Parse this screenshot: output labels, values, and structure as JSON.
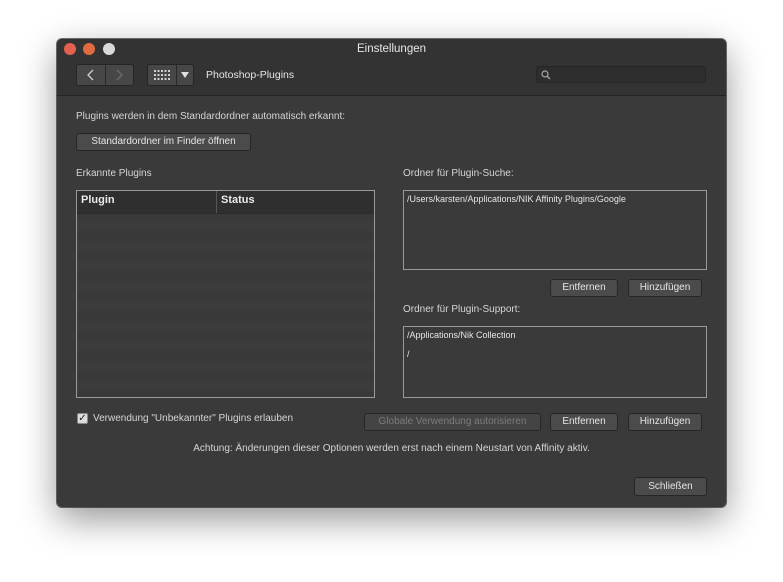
{
  "window": {
    "title": "Einstellungen"
  },
  "toolbar": {
    "back_icon": "chevron-left-icon",
    "forward_icon": "chevron-right-icon",
    "grid_icon": "grid-icon",
    "menu_icon": "triangle-down-icon",
    "section_title": "Photoshop-Plugins",
    "search_icon": "search-icon",
    "search_value": ""
  },
  "main": {
    "auto_detect_text": "Plugins werden in dem Standardordner automatisch erkannt:",
    "open_default_folder_button": "Standardordner im Finder öffnen",
    "detected_plugins_label": "Erkannte Plugins",
    "plugins_table": {
      "columns": [
        "Plugin",
        "Status"
      ],
      "rows": []
    },
    "search_folders_label": "Ordner für Plugin-Suche:",
    "search_folders": [
      "/Users/karsten/Applications/NIK Affinity Plugins/Google"
    ],
    "search_remove_button": "Entfernen",
    "search_add_button": "Hinzufügen",
    "support_folders_label": "Ordner für Plugin-Support:",
    "support_folders": [
      "/Applications/Nik Collection",
      "/"
    ],
    "support_remove_button": "Entfernen",
    "support_add_button": "Hinzufügen",
    "allow_unknown_label": "Verwendung \"Unbekannter\" Plugins erlauben",
    "allow_unknown_checked": true,
    "authorize_global_button": "Globale Verwendung autorisieren",
    "warning_text": "Achtung: Änderungen dieser Optionen werden erst nach einem Neustart von Affinity aktiv.",
    "close_button": "Schließen"
  },
  "colors": {
    "window_bg": "#3a3a3a",
    "titlebar_bg": "#333333",
    "close_dot": "#e5614f",
    "minimize_dot": "#df6b3e",
    "zoom_dot": "#d9d9d9"
  }
}
